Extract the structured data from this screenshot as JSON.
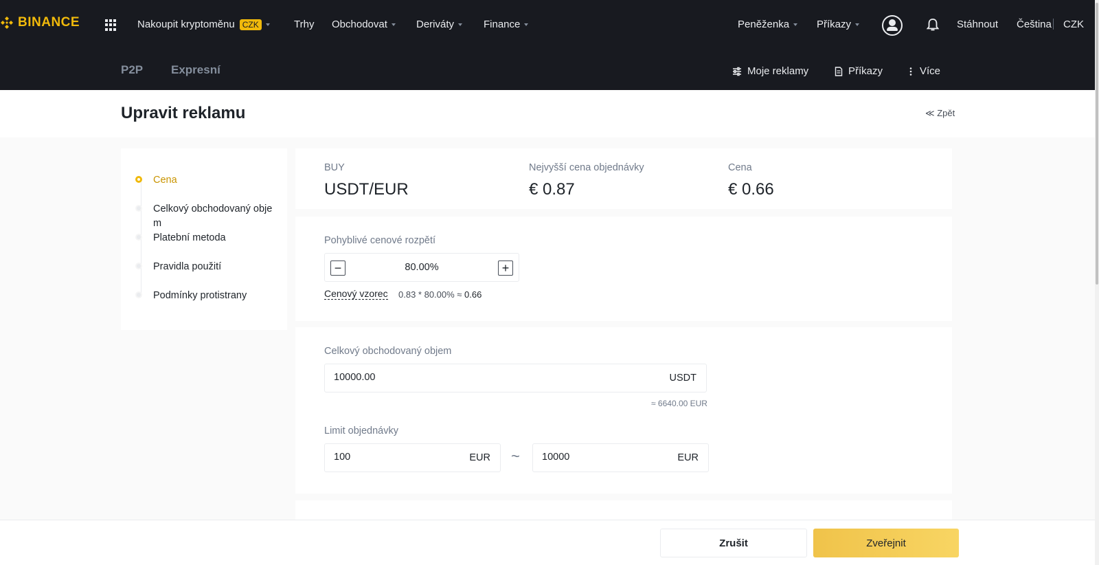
{
  "brand": {
    "name": "BINANCE",
    "color": "#f0b90b"
  },
  "topnav": {
    "buy_crypto": "Nakoupit kryptoměnu",
    "currency_badge": "CZK",
    "markets": "Trhy",
    "trade": "Obchodovat",
    "derivatives": "Deriváty",
    "finance": "Finance",
    "wallet": "Peněženka",
    "orders": "Příkazy",
    "download": "Stáhnout",
    "language": "Čeština",
    "currency": "CZK"
  },
  "subnav": {
    "p2p": "P2P",
    "express": "Expresní",
    "my_ads": "Moje reklamy",
    "orders": "Příkazy",
    "more": "Více"
  },
  "header": {
    "title": "Upravit reklamu",
    "back": "≪ Zpět"
  },
  "steps": [
    {
      "label": "Cena",
      "active": true
    },
    {
      "label": "Celkový obchodovaný obje m",
      "active": false
    },
    {
      "label": "Platební metoda",
      "active": false
    },
    {
      "label": "Pravidla použití",
      "active": false
    },
    {
      "label": "Podmínky protistrany",
      "active": false
    }
  ],
  "summary": {
    "side": "BUY",
    "pair": "USDT/EUR",
    "highest_label": "Nejvyšší cena objednávky",
    "highest_value": "€ 0.87",
    "price_label": "Cena",
    "price_value": "€ 0.66"
  },
  "pricing": {
    "floating_label": "Pohyblivé cenové rozpětí",
    "floating_value": "80.00%",
    "minus": "−",
    "plus": "+",
    "formula_label": "Cenový vzorec",
    "formula_expr": "0.83 * 80.00% ≈",
    "formula_result": "0.66"
  },
  "amount": {
    "total_label": "Celkový obchodovaný objem",
    "total_value": "10000.00",
    "total_unit": "USDT",
    "total_approx": "≈ 6640.00 EUR",
    "limit_label": "Limit objednávky",
    "min_value": "100",
    "min_unit": "EUR",
    "separator": "~",
    "max_value": "10000",
    "max_unit": "EUR"
  },
  "footer": {
    "cancel": "Zrušit",
    "publish": "Zveřejnit"
  }
}
